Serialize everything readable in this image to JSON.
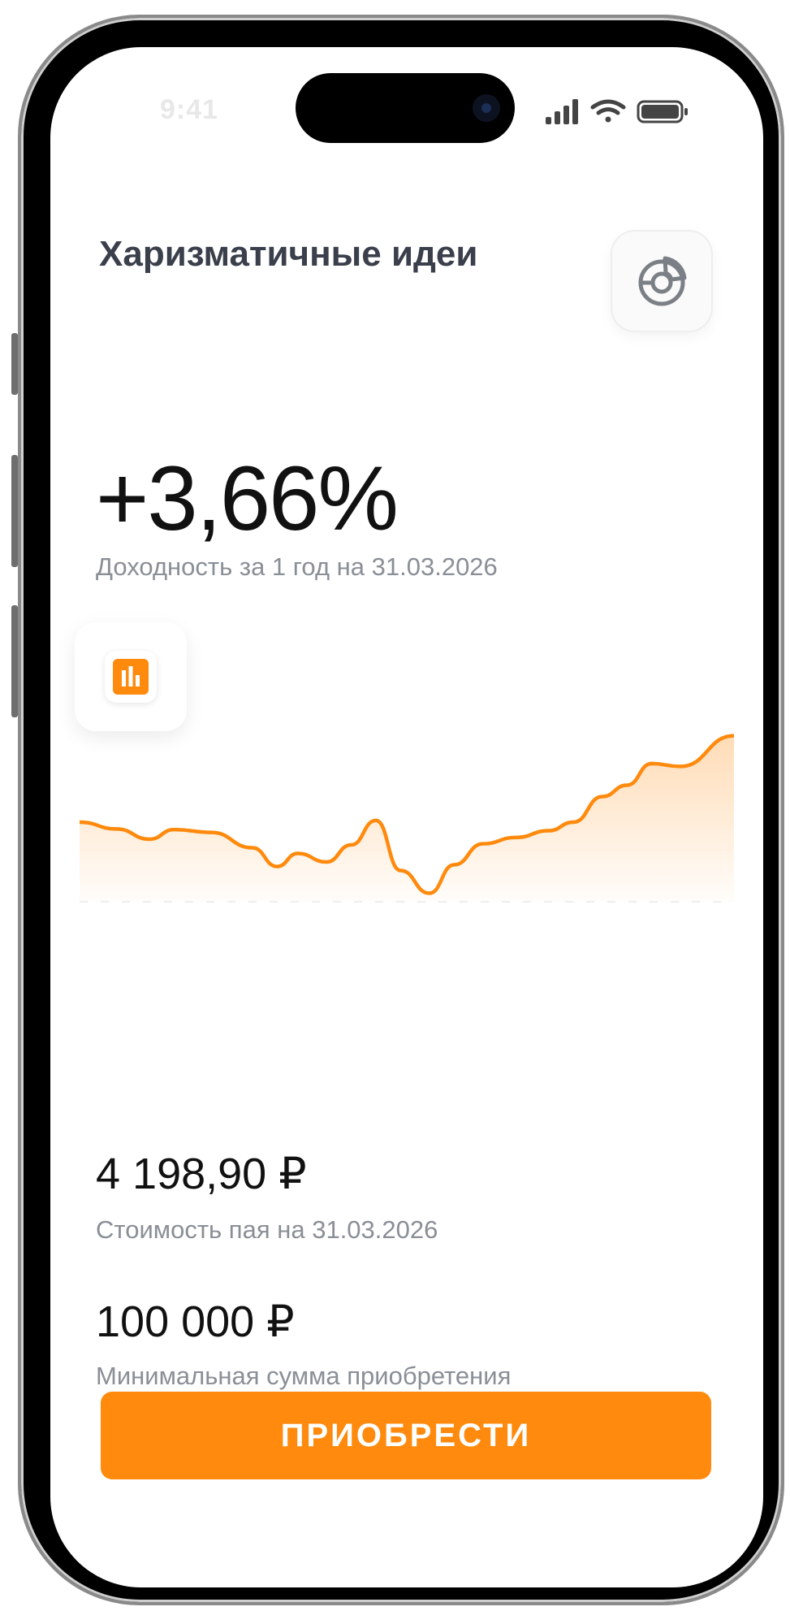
{
  "status_bar": {
    "time": "9:41"
  },
  "header": {
    "title": "Харизматичные идеи"
  },
  "yield": {
    "value": "+3,66%",
    "caption": "Доходность за 1 год на 31.03.2026"
  },
  "share_price": {
    "value": "4 198,90 ₽",
    "caption": "Стоимость пая на 31.03.2026"
  },
  "min_purchase": {
    "value": "100 000 ₽",
    "caption": "Минимальная сумма приобретения"
  },
  "buy_button": {
    "label": "ПРИОБРЕСТИ"
  },
  "colors": {
    "accent": "#ff8a0d",
    "text": "#111111",
    "muted": "#8a8e96"
  },
  "icons": {
    "top_right": "donut-chart-icon",
    "chart_toggle": "bar-chart-icon"
  },
  "chart_data": {
    "type": "area",
    "values": [
      11.0,
      9.8,
      8.0,
      9.7,
      9.2,
      6.5,
      3.2,
      5.5,
      4.0,
      7.0,
      11.3,
      2.5,
      -1.5,
      3.5,
      7.2,
      8.3,
      9.5,
      11.0,
      15.5,
      17.5,
      21.3,
      20.8,
      26.2
    ],
    "x": [
      0,
      45,
      85,
      115,
      160,
      210,
      240,
      265,
      300,
      330,
      360,
      390,
      425,
      455,
      490,
      530,
      570,
      600,
      635,
      665,
      695,
      730,
      795
    ],
    "ylim": [
      -3,
      28
    ],
    "title": "",
    "xlabel": "",
    "ylabel": ""
  }
}
